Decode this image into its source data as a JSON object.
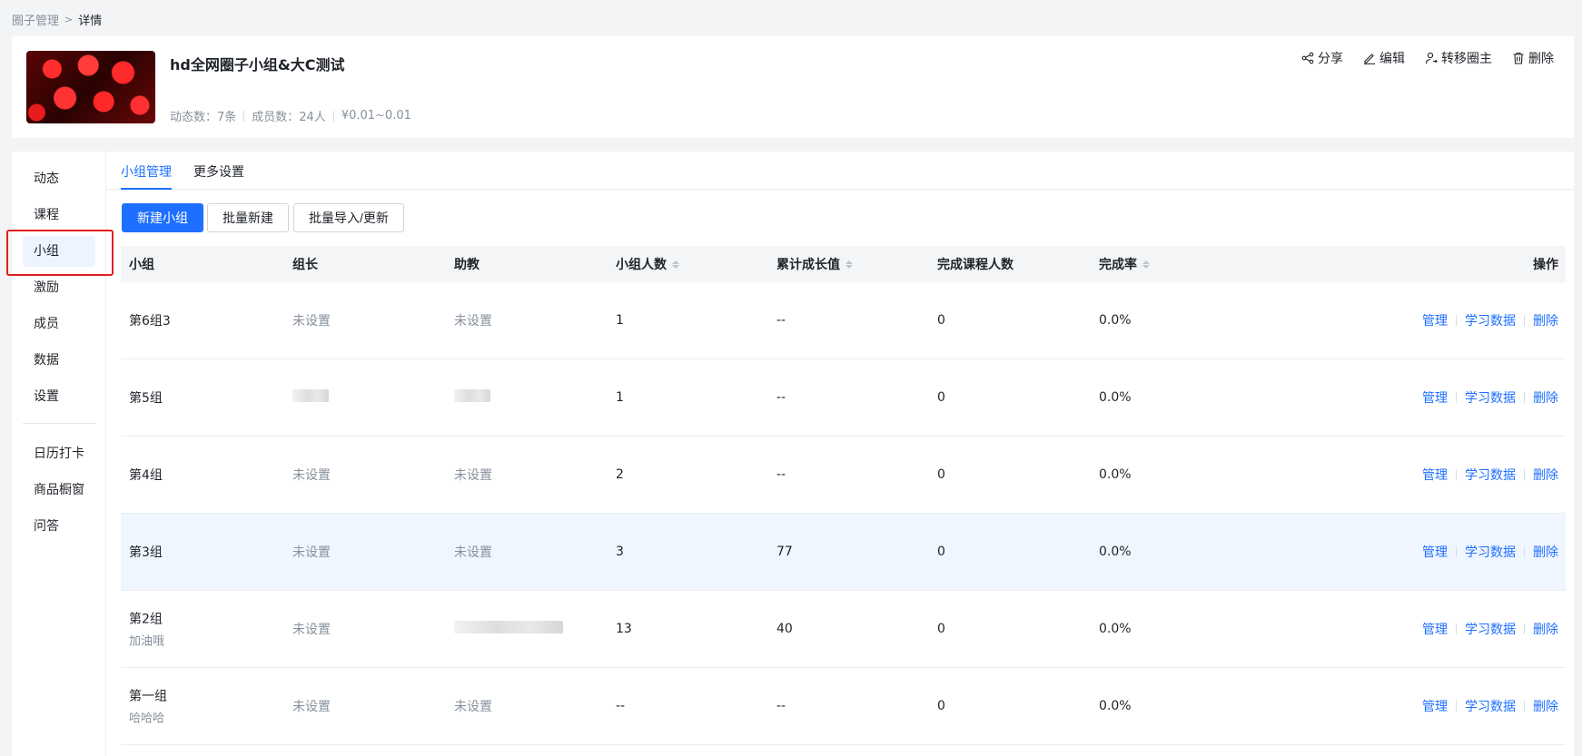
{
  "breadcrumb": {
    "parent": "圈子管理",
    "current": "详情"
  },
  "circle": {
    "title": "hd全网圈子小组&大C测试",
    "posts": "动态数：7条",
    "members": "成员数：24人",
    "price": "¥0.01~0.01"
  },
  "header_actions": {
    "share": "分享",
    "edit": "编辑",
    "transfer": "转移圈主",
    "delete": "删除"
  },
  "sidenav": {
    "items": [
      "动态",
      "课程",
      "小组",
      "激励",
      "成员",
      "数据",
      "设置",
      "日历打卡",
      "商品橱窗",
      "问答"
    ],
    "active": "小组"
  },
  "tabs": [
    "小组管理",
    "更多设置"
  ],
  "buttons": {
    "new_group": "新建小组",
    "batch_new": "批量新建",
    "batch_import": "批量导入/更新"
  },
  "table": {
    "headers": {
      "group": "小组",
      "leader": "组长",
      "assistant": "助教",
      "size": "小组人数",
      "growth": "累计成长值",
      "completed": "完成课程人数",
      "rate": "完成率",
      "ops": "操作"
    },
    "rows": [
      {
        "name": "第6组3",
        "sub": "",
        "leader": "未设置",
        "assistant": "未设置",
        "size": "1",
        "growth": "--",
        "completed": "0",
        "rate": "0.0%"
      },
      {
        "name": "第5组",
        "sub": "",
        "leader": "",
        "assistant": "",
        "size": "1",
        "growth": "--",
        "completed": "0",
        "rate": "0.0%"
      },
      {
        "name": "第4组",
        "sub": "",
        "leader": "未设置",
        "assistant": "未设置",
        "size": "2",
        "growth": "--",
        "completed": "0",
        "rate": "0.0%"
      },
      {
        "name": "第3组",
        "sub": "",
        "leader": "未设置",
        "assistant": "未设置",
        "size": "3",
        "growth": "77",
        "completed": "0",
        "rate": "0.0%"
      },
      {
        "name": "第2组",
        "sub": "加油哦",
        "leader": "未设置",
        "assistant": "",
        "size": "13",
        "growth": "40",
        "completed": "0",
        "rate": "0.0%"
      },
      {
        "name": "第一组",
        "sub": "哈哈哈",
        "leader": "未设置",
        "assistant": "未设置",
        "size": "--",
        "growth": "--",
        "completed": "0",
        "rate": "0.0%"
      }
    ],
    "ops": {
      "manage": "管理",
      "study": "学习数据",
      "delete": "删除"
    }
  },
  "colors": {
    "accent": "#1e6fff",
    "highlight": "#e02020"
  }
}
